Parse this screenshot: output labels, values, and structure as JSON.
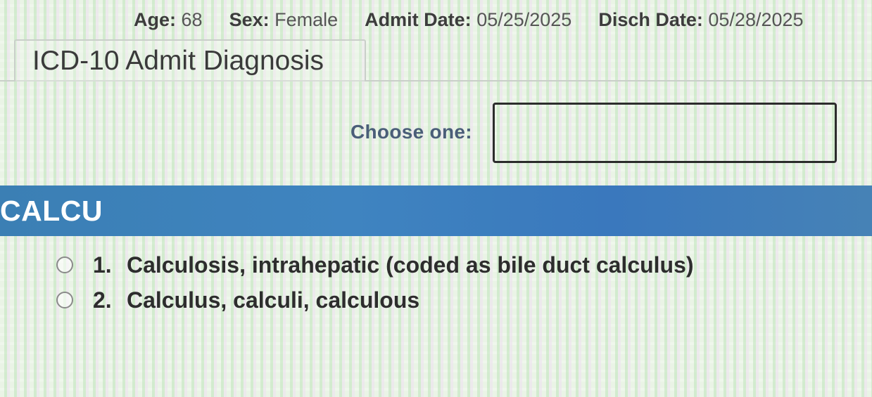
{
  "patient": {
    "age_label": "Age:",
    "age_value": "68",
    "sex_label": "Sex:",
    "sex_value": "Female",
    "admit_label": "Admit Date:",
    "admit_value": "05/25/2025",
    "disch_label": "Disch Date:",
    "disch_value": "05/28/2025"
  },
  "tab": {
    "label": "ICD-10 Admit Diagnosis"
  },
  "chooser": {
    "label": "Choose one:",
    "value": ""
  },
  "term": {
    "text": "CALCU"
  },
  "options": [
    {
      "number": "1.",
      "text": "Calculosis, intrahepatic (coded as bile duct calculus)"
    },
    {
      "number": "2.",
      "text": "Calculus, calculi, calculous"
    }
  ],
  "colors": {
    "term_bar": "#3f84c0",
    "choose_label": "#4a5e78",
    "input_border": "#2c2c2c"
  }
}
